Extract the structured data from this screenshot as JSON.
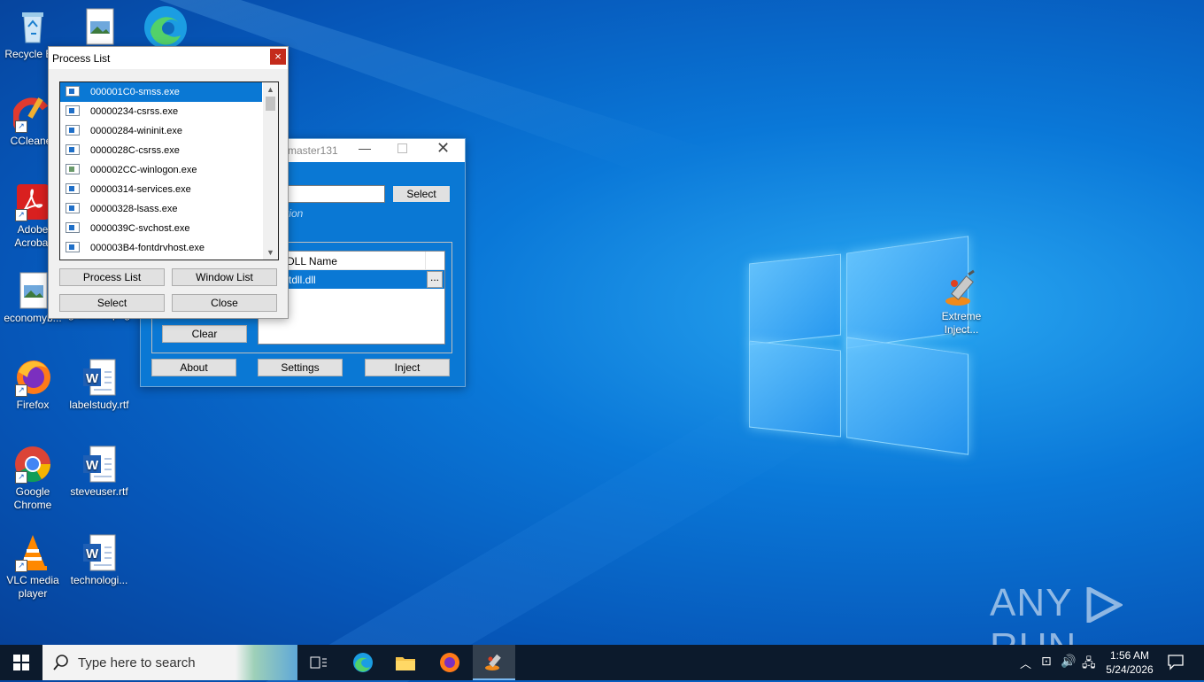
{
  "desktop": {
    "icons": [
      {
        "label": "Recycle Bin",
        "icon": "recycle-bin-icon"
      },
      {
        "label": "",
        "icon": "image-file-icon"
      },
      {
        "label": "",
        "icon": "edge-icon"
      },
      {
        "label": "CCleaner",
        "icon": "ccleaner-icon"
      },
      {
        "label": "Adobe Acrobat",
        "icon": "acrobat-icon"
      },
      {
        "label": "economyb...",
        "icon": "image-file-icon"
      },
      {
        "label": "granttest.png",
        "icon": "image-file-icon"
      },
      {
        "label": "Firefox",
        "icon": "firefox-icon"
      },
      {
        "label": "labelstudy.rtf",
        "icon": "word-doc-icon"
      },
      {
        "label": "Google Chrome",
        "icon": "chrome-icon"
      },
      {
        "label": "steveuser.rtf",
        "icon": "word-doc-icon"
      },
      {
        "label": "VLC media player",
        "icon": "vlc-icon"
      },
      {
        "label": "technologi...",
        "icon": "word-doc-icon"
      },
      {
        "label": "Extreme Inject...",
        "icon": "extreme-injector-icon"
      }
    ]
  },
  "injector_window": {
    "title_fragment": "master131",
    "select_label": "Select",
    "hint_fragment": "tion",
    "dll_column_header": "DLL Name",
    "dll_rows": [
      {
        "name": "tdll.dll"
      }
    ],
    "browse_label": "...",
    "clear_label": "Clear",
    "about_label": "About",
    "settings_label": "Settings",
    "inject_label": "Inject"
  },
  "process_window": {
    "title": "Process List",
    "close_glyph": "×",
    "processes": [
      "000001C0-smss.exe",
      "00000234-csrss.exe",
      "00000284-wininit.exe",
      "0000028C-csrss.exe",
      "000002CC-winlogon.exe",
      "00000314-services.exe",
      "00000328-lsass.exe",
      "0000039C-svchost.exe",
      "000003B4-fontdrvhost.exe"
    ],
    "selected_index": 0,
    "process_list_label": "Process List",
    "window_list_label": "Window List",
    "select_label": "Select",
    "close_label": "Close"
  },
  "taskbar": {
    "search_placeholder": "Type here to search",
    "time": "1:56 AM",
    "date": "5/24/2026"
  },
  "watermark": {
    "left": "ANY",
    "right": "RUN"
  }
}
